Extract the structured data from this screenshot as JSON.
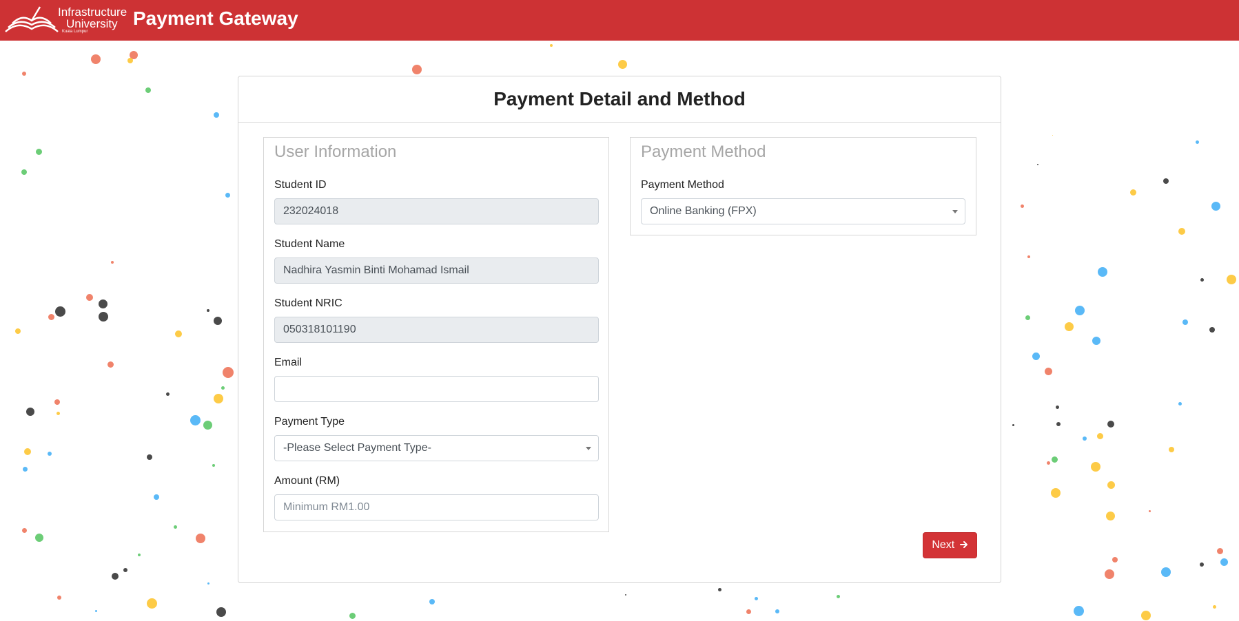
{
  "header": {
    "logo_line1": "Infrastructure",
    "logo_line2": "University",
    "logo_line3": "Kuala Lumpur",
    "title": "Payment Gateway",
    "color": "#cd3234"
  },
  "card": {
    "title": "Payment Detail and Method"
  },
  "user_info": {
    "legend": "User Information",
    "student_id_label": "Student ID",
    "student_id_value": "232024018",
    "student_name_label": "Student Name",
    "student_name_value": "Nadhira Yasmin Binti Mohamad Ismail",
    "student_nric_label": "Student NRIC",
    "student_nric_value": "050318101190",
    "email_label": "Email",
    "email_value": "",
    "payment_type_label": "Payment Type",
    "payment_type_selected": "-Please Select Payment Type-",
    "amount_label": "Amount (RM)",
    "amount_placeholder": "Minimum RM1.00"
  },
  "payment_method": {
    "legend": "Payment Method",
    "label": "Payment Method",
    "selected": "Online Banking (FPX)"
  },
  "actions": {
    "next_label": "Next",
    "next_icon": "arrow-right-icon",
    "button_color": "#d33336"
  },
  "confetti_colors": [
    "#f0836b",
    "#fdcb47",
    "#5ab9f7",
    "#6ccd77",
    "#4a4a4a"
  ]
}
